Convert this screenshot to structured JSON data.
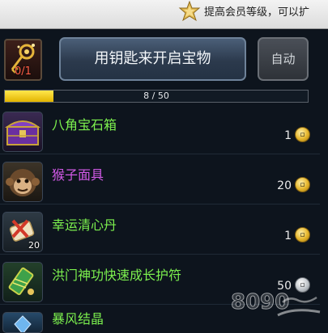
{
  "banner": {
    "text": "提高会员等级，可以扩",
    "icon": "vip-crown-icon"
  },
  "key_slot": {
    "count": "0/1",
    "icon": "golden-key-icon"
  },
  "open_button": {
    "label": "用钥匙来开启宝物"
  },
  "auto_button": {
    "label": "自动"
  },
  "progress": {
    "text": "8 / 50",
    "current": 8,
    "max": 50,
    "fill_color": "#f2cc14"
  },
  "items": [
    {
      "name": "八角宝石箱",
      "qty": "1",
      "name_color": "#7cf04e",
      "coin": "gold",
      "icon": "purple-treasure-chest-icon",
      "badge": ""
    },
    {
      "name": "猴子面具",
      "qty": "20",
      "name_color": "#d35ae8",
      "coin": "gold",
      "icon": "monkey-mask-icon",
      "badge": ""
    },
    {
      "name": "幸运清心丹",
      "qty": "1",
      "name_color": "#7cf04e",
      "coin": "gold",
      "icon": "pill-scroll-icon",
      "badge": "20"
    },
    {
      "name": "洪门神功快速成长护符",
      "qty": "50",
      "name_color": "#7cf04e",
      "coin": "silver",
      "icon": "talisman-icon",
      "badge": ""
    },
    {
      "name": "暴风结晶",
      "qty": "",
      "name_color": "#7cf04e",
      "coin": "none",
      "icon": "crystal-icon",
      "badge": ""
    }
  ],
  "watermark": {
    "text": "8090",
    "icon": "site-watermark-logo"
  }
}
